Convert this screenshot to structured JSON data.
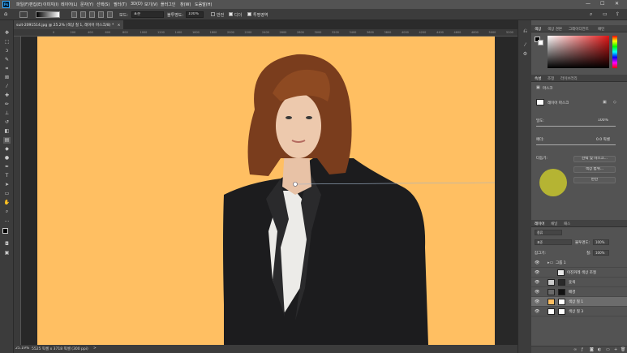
{
  "menubar": {
    "logo": "Ps",
    "items": [
      "파일(F)",
      "편집(E)",
      "이미지(I)",
      "레이어(L)",
      "문자(Y)",
      "선택(S)",
      "필터(T)",
      "3D(D)",
      "보기(V)",
      "플러그인",
      "창(W)",
      "도움말(H)"
    ],
    "window_controls": [
      "—",
      "☐",
      "✕"
    ]
  },
  "options": {
    "mode_label": "모드:",
    "mode_value": "표준",
    "opacity_label": "불투명도:",
    "opacity_value": "100%",
    "reverse_label": "반전",
    "dither_label": "디더",
    "transparency_label": "투명영역"
  },
  "document_tab": {
    "title": "suit-2091514.jpg @ 25.2% (색상 칠 1, 레이어 마스크/8) *",
    "close": "×"
  },
  "ruler": {
    "ticks": [
      "0",
      "200",
      "400",
      "600",
      "800",
      "1000",
      "1200",
      "1400",
      "1600",
      "1800",
      "2000",
      "2200",
      "2400",
      "2600",
      "2800",
      "3000",
      "3200",
      "3400",
      "3600",
      "3800",
      "4000",
      "4200",
      "4400",
      "4600",
      "4800",
      "5000",
      "5200"
    ]
  },
  "statusbar": {
    "zoom": "25.19%",
    "doc_info": "5525 픽셀 x 3718 픽셀 (300 ppi)",
    "arrow": ">"
  },
  "color_panel": {
    "tabs": [
      "색상",
      "색상 견본",
      "그레이디언트",
      "패턴"
    ]
  },
  "properties_panel": {
    "tabs": [
      "속성",
      "조정",
      "라이브러리"
    ],
    "section": "마스크",
    "mask_label": "레이어 마스크",
    "density_label": "밀도:",
    "density_value": "100%",
    "feather_label": "페더:",
    "feather_value": "0.0 픽셀",
    "refine_label": "다듬기:",
    "btn_select_mask": "선택 및 마스크...",
    "btn_color_range": "색상 범위...",
    "btn_invert": "반전"
  },
  "layers_panel": {
    "tabs": [
      "레이어",
      "채널",
      "패스"
    ],
    "filter_value": "종류",
    "blend_value": "표준",
    "opacity_label": "불투명도:",
    "opacity_value": "100%",
    "lock_label": "잠그기:",
    "fill_label": "칠:",
    "fill_value": "100%",
    "layers": [
      {
        "name": "그룹 1",
        "thumb_color": "#5a5a5a",
        "selected": false
      },
      {
        "name": "이진커레 색상 조절",
        "thumb_color": "#e8e8e8",
        "selected": false
      },
      {
        "name": "옷색",
        "thumb_color": "#2a2a2a",
        "selected": false
      },
      {
        "name": "배경",
        "thumb_color": "#3a3a3a",
        "selected": false
      },
      {
        "name": "색상 칠 1",
        "thumb_color": "#ffbf62",
        "selected": true
      },
      {
        "name": "색상 칠 3",
        "thumb_color": "#ffffff",
        "selected": false
      }
    ]
  },
  "colors": {
    "canvas_bg": "#ffbf62",
    "accent": "#31a8ff"
  }
}
